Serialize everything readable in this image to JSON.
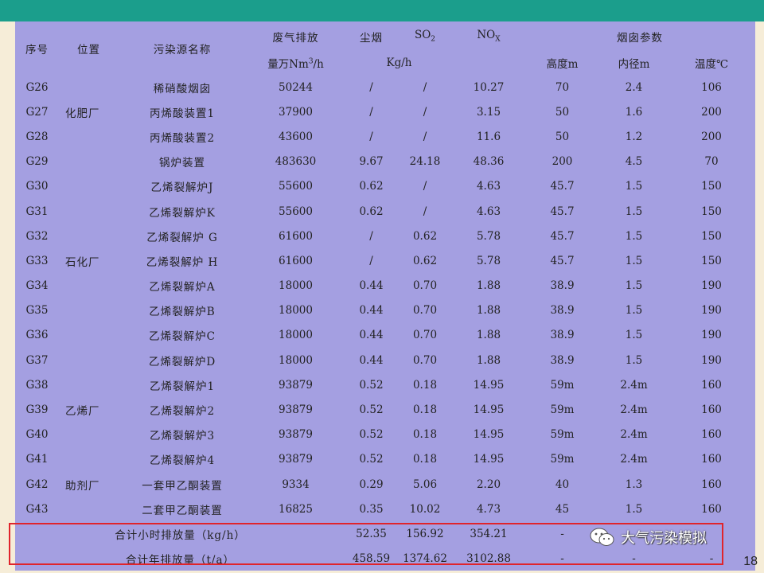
{
  "slide": {
    "page_number": "18"
  },
  "watermark": {
    "text": "大气污染模拟",
    "icon": "wechat-icon"
  },
  "colors": {
    "topbar": "#1b9e8c",
    "table_bg": "#a49fe1",
    "slide_bg": "#f6edd8",
    "highlight_box": "#e0242b"
  },
  "header": {
    "no": "序号",
    "location": "位置",
    "source_name": "污染源名称",
    "exhaust_line1": "废气排放",
    "exhaust_line2_pre": "量万Nm",
    "exhaust_line2_sup": "3",
    "exhaust_line2_post": "/h",
    "dust": "尘烟",
    "so2_main": "SO",
    "so2_sub": "2",
    "nox_main": "NO",
    "nox_sub": "X",
    "unit_kgh": "Kg/h",
    "stack_params": "烟囱参数",
    "height": "高度m",
    "diameter": "内径m",
    "temperature": "温度℃"
  },
  "rows": [
    {
      "no": "G26",
      "loc": "",
      "name": "稀硝酸烟囱",
      "flow": "50244",
      "dust": "/",
      "so2": "/",
      "nox": "10.27",
      "h": "70",
      "d": "2.4",
      "t": "106"
    },
    {
      "no": "G27",
      "loc": "化肥厂",
      "name": "丙烯酸装置1",
      "flow": "37900",
      "dust": "/",
      "so2": "/",
      "nox": "3.15",
      "h": "50",
      "d": "1.6",
      "t": "200"
    },
    {
      "no": "G28",
      "loc": "",
      "name": "丙烯酸装置2",
      "flow": "43600",
      "dust": "/",
      "so2": "/",
      "nox": "11.6",
      "h": "50",
      "d": "1.2",
      "t": "200"
    },
    {
      "no": "G29",
      "loc": "",
      "name": "锅炉装置",
      "flow": "483630",
      "dust": "9.67",
      "so2": "24.18",
      "nox": "48.36",
      "h": "200",
      "d": "4.5",
      "t": "70"
    },
    {
      "no": "G30",
      "loc": "",
      "name": "乙烯裂解炉J",
      "flow": "55600",
      "dust": "0.62",
      "so2": "/",
      "nox": "4.63",
      "h": "45.7",
      "d": "1.5",
      "t": "150"
    },
    {
      "no": "G31",
      "loc": "",
      "name": "乙烯裂解炉K",
      "flow": "55600",
      "dust": "0.62",
      "so2": "/",
      "nox": "4.63",
      "h": "45.7",
      "d": "1.5",
      "t": "150"
    },
    {
      "no": "G32",
      "loc": "",
      "name": "乙烯裂解炉 G",
      "flow": "61600",
      "dust": "/",
      "so2": "0.62",
      "nox": "5.78",
      "h": "45.7",
      "d": "1.5",
      "t": "150"
    },
    {
      "no": "G33",
      "loc": "石化厂",
      "name": "乙烯裂解炉 H",
      "flow": "61600",
      "dust": "/",
      "so2": "0.62",
      "nox": "5.78",
      "h": "45.7",
      "d": "1.5",
      "t": "150"
    },
    {
      "no": "G34",
      "loc": "",
      "name": "乙烯裂解炉A",
      "flow": "18000",
      "dust": "0.44",
      "so2": "0.70",
      "nox": "1.88",
      "h": "38.9",
      "d": "1.5",
      "t": "190"
    },
    {
      "no": "G35",
      "loc": "",
      "name": "乙烯裂解炉B",
      "flow": "18000",
      "dust": "0.44",
      "so2": "0.70",
      "nox": "1.88",
      "h": "38.9",
      "d": "1.5",
      "t": "190"
    },
    {
      "no": "G36",
      "loc": "",
      "name": "乙烯裂解炉C",
      "flow": "18000",
      "dust": "0.44",
      "so2": "0.70",
      "nox": "1.88",
      "h": "38.9",
      "d": "1.5",
      "t": "190"
    },
    {
      "no": "G37",
      "loc": "",
      "name": "乙烯裂解炉D",
      "flow": "18000",
      "dust": "0.44",
      "so2": "0.70",
      "nox": "1.88",
      "h": "38.9",
      "d": "1.5",
      "t": "190"
    },
    {
      "no": "G38",
      "loc": "",
      "name": "乙烯裂解炉1",
      "flow": "93879",
      "dust": "0.52",
      "so2": "0.18",
      "nox": "14.95",
      "h": "59m",
      "d": "2.4m",
      "t": "160"
    },
    {
      "no": "G39",
      "loc": "乙烯厂",
      "name": "乙烯裂解炉2",
      "flow": "93879",
      "dust": "0.52",
      "so2": "0.18",
      "nox": "14.95",
      "h": "59m",
      "d": "2.4m",
      "t": "160"
    },
    {
      "no": "G40",
      "loc": "",
      "name": "乙烯裂解炉3",
      "flow": "93879",
      "dust": "0.52",
      "so2": "0.18",
      "nox": "14.95",
      "h": "59m",
      "d": "2.4m",
      "t": "160"
    },
    {
      "no": "G41",
      "loc": "",
      "name": "乙烯裂解炉4",
      "flow": "93879",
      "dust": "0.52",
      "so2": "0.18",
      "nox": "14.95",
      "h": "59m",
      "d": "2.4m",
      "t": "160"
    },
    {
      "no": "G42",
      "loc": "助剂厂",
      "name": "一套甲乙酮装置",
      "flow": "9334",
      "dust": "0.29",
      "so2": "5.06",
      "nox": "2.20",
      "h": "40",
      "d": "1.3",
      "t": "160"
    },
    {
      "no": "G43",
      "loc": "",
      "name": "二套甲乙酮装置",
      "flow": "16825",
      "dust": "0.35",
      "so2": "10.02",
      "nox": "4.73",
      "h": "45",
      "d": "1.5",
      "t": "160"
    }
  ],
  "totals": [
    {
      "label": "合计小时排放量（kg/h）",
      "dust": "52.35",
      "so2": "156.92",
      "nox": "354.21",
      "h": "-",
      "d": "",
      "t": ""
    },
    {
      "label": "合计年排放量（t/a）",
      "dust": "458.59",
      "so2": "1374.62",
      "nox": "3102.88",
      "h": "-",
      "d": "-",
      "t": "-"
    }
  ]
}
